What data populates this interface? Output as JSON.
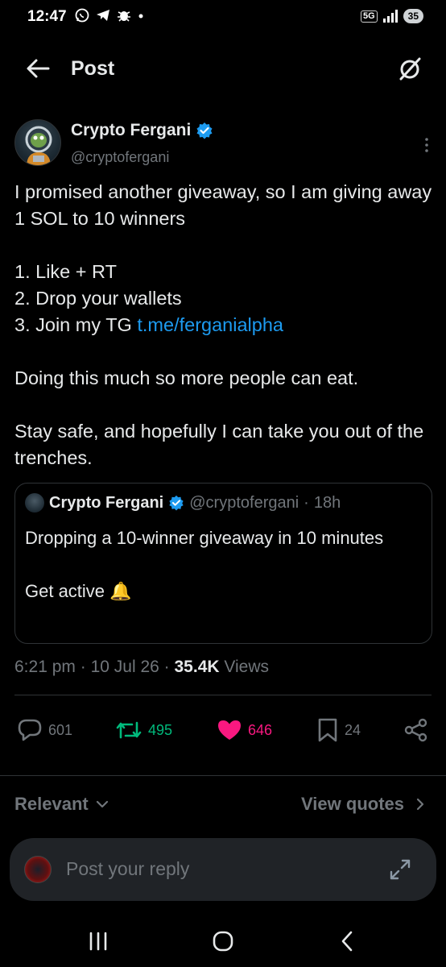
{
  "status_bar": {
    "time": "12:47",
    "network": "5G",
    "battery": "35"
  },
  "header": {
    "title": "Post"
  },
  "post": {
    "author_name": "Crypto Fergani",
    "author_handle": "@cryptofergani",
    "line1": "I promised another giveaway, so I am giving away 1 SOL to 10 winners",
    "step1": "1. Like + RT",
    "step2": "2. Drop your wallets",
    "step3_prefix": "3. Join my TG",
    "step3_link": "t.me/ferganialpha",
    "line3": "Doing this much so more people can eat.",
    "line4": "Stay safe, and hopefully I can take you out of the trenches."
  },
  "quote": {
    "author_name": "Crypto Fergani",
    "author_handle": "@cryptofergani",
    "separator": "·",
    "age": "18h",
    "text1": "Dropping a 10-winner giveaway in 10 minutes",
    "text2": "Get active 🔔"
  },
  "meta": {
    "time": "6:21 pm",
    "dot1": "·",
    "date": "10 Jul 26",
    "dot2": "·",
    "views_count": "35.4K",
    "views_label": "Views"
  },
  "actions": {
    "replies": "601",
    "reposts": "495",
    "likes": "646",
    "bookmarks": "24"
  },
  "sort": {
    "left_label": "Relevant",
    "right_label": "View quotes"
  },
  "reply": {
    "placeholder": "Post your reply"
  },
  "colors": {
    "background": "#000000",
    "text": "#e7e9ea",
    "muted": "#71767b",
    "link": "#1d9bf0",
    "verified": "#1d9bf0",
    "repost": "#00ba7c",
    "like": "#f91880",
    "border": "#2f3336"
  },
  "icons": [
    "whatsapp-icon",
    "telegram-icon",
    "bug-icon",
    "signal-icon",
    "back-arrow-icon",
    "grok-icon",
    "verified-badge-icon",
    "more-vertical-icon",
    "reply-icon",
    "repost-icon",
    "heart-icon",
    "bookmark-icon",
    "share-icon",
    "chevron-down-icon",
    "chevron-right-icon",
    "expand-icon",
    "recent-apps-icon",
    "home-icon",
    "back-icon"
  ]
}
